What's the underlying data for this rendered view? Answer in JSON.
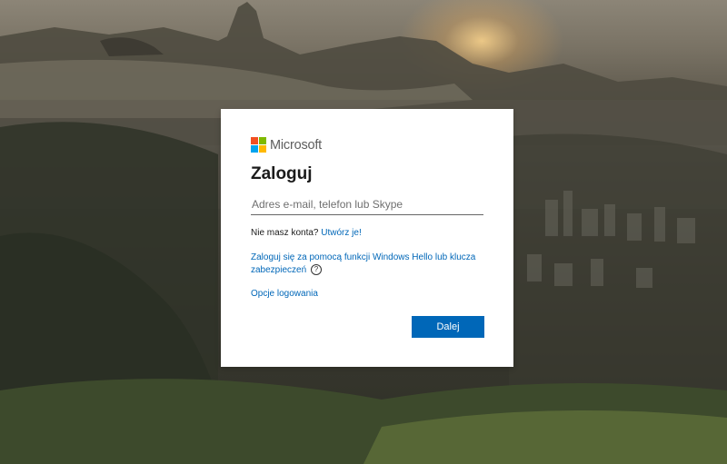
{
  "brand": {
    "name": "Microsoft",
    "logo_colors": [
      "#f25022",
      "#7fba00",
      "#00a4ef",
      "#ffb900"
    ]
  },
  "signin": {
    "title": "Zaloguj",
    "email_placeholder": "Adres e-mail, telefon lub Skype",
    "email_value": "",
    "no_account_text": "Nie masz konta?",
    "create_link": "Utwórz je!",
    "hello_link": "Zaloguj się za pomocą funkcji Windows Hello lub klucza zabezpieczeń",
    "help_icon_glyph": "?",
    "options_link": "Opcje logowania",
    "next_button": "Dalej"
  },
  "colors": {
    "accent": "#0067b8",
    "text": "#1b1b1b"
  },
  "icons": {
    "logo": "microsoft-logo-icon",
    "help": "question-circle-icon"
  }
}
